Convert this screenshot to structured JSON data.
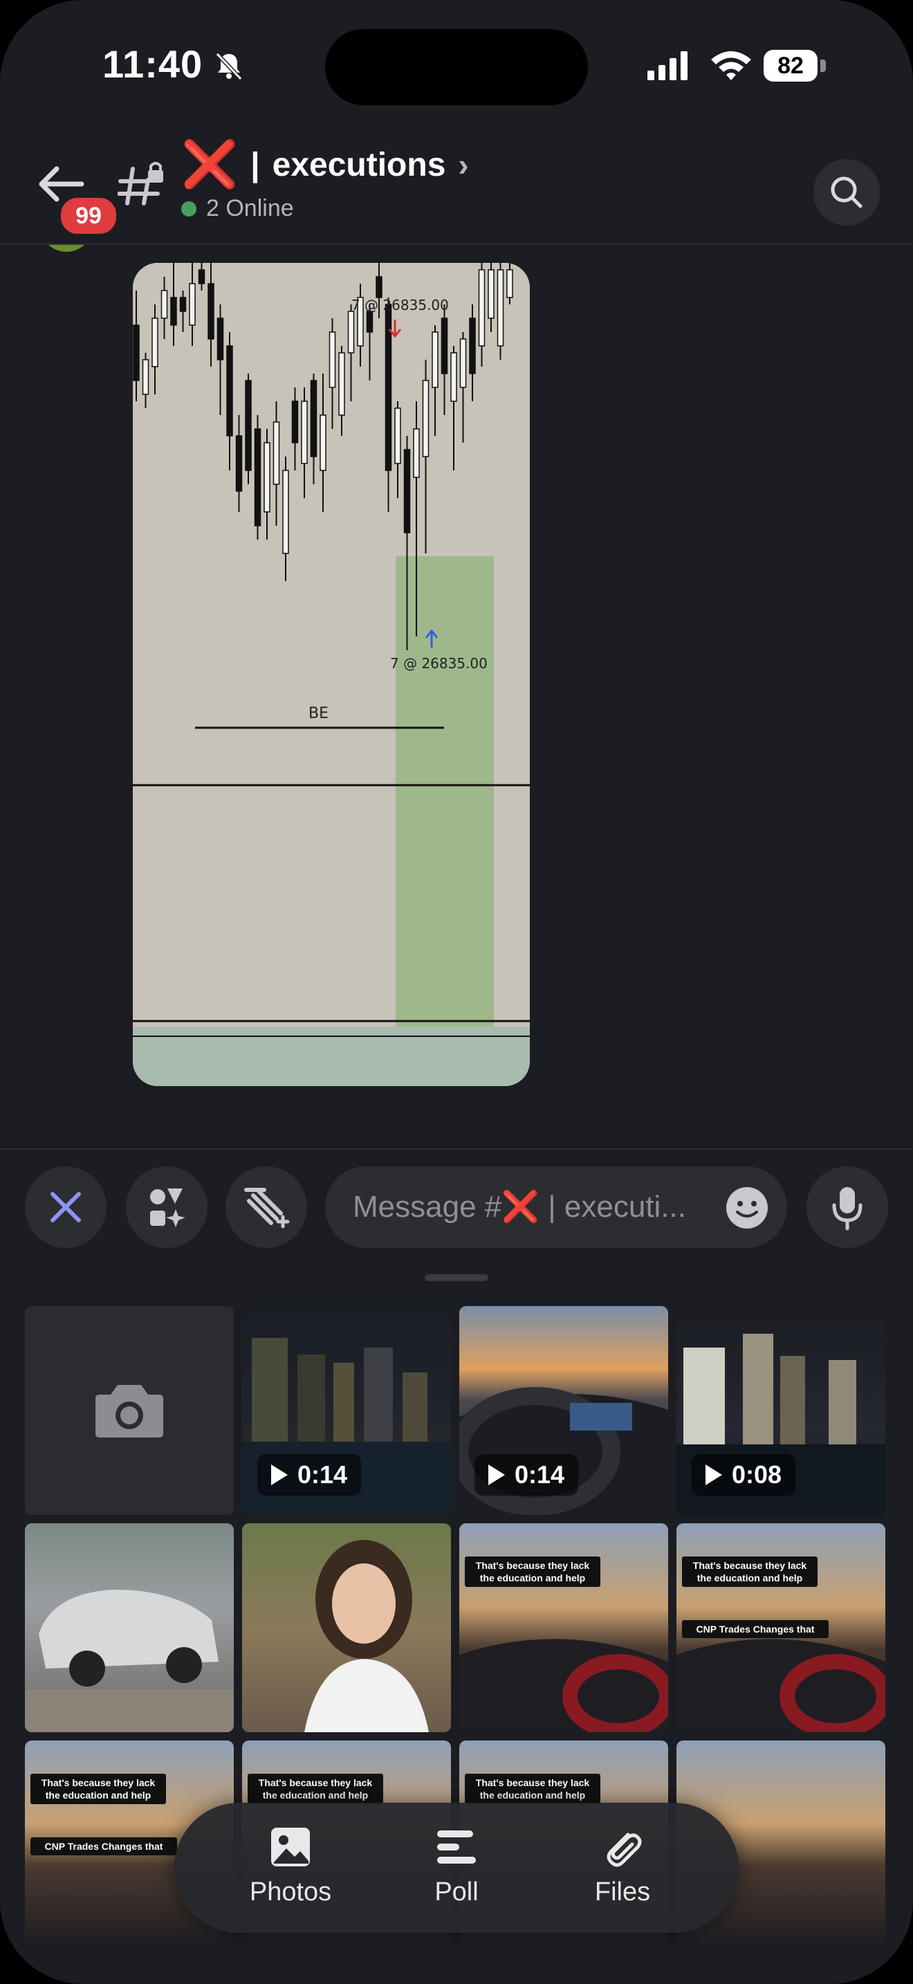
{
  "status_bar": {
    "time": "11:40",
    "battery": "82"
  },
  "header": {
    "unread_badge": "99",
    "channel_emoji": "❌",
    "channel_separator": "|",
    "channel_name": "executions",
    "chevron": "›",
    "online_text": "2 Online",
    "online_color": "#43a25a",
    "icons": [
      "back-arrow-icon",
      "locked-channel-icon",
      "search-icon"
    ]
  },
  "message": {
    "chart_labels": {
      "sell_label": "7 @ 26835.00",
      "buy_label": "7 @ 26835.00",
      "be_label": "BE"
    }
  },
  "composer": {
    "placeholder_prefix": "Message #",
    "placeholder_emoji": "❌",
    "placeholder_suffix": " | executi...",
    "icons": [
      "close-icon",
      "apps-icon",
      "gift-sparkle-icon",
      "emoji-icon",
      "microphone-icon"
    ],
    "accent": "#8e93f5"
  },
  "gallery": {
    "videos": [
      {
        "duration": "0:14"
      },
      {
        "duration": "0:14"
      },
      {
        "duration": "0:08"
      }
    ],
    "captions": {
      "education": "That's because they lack the education and help",
      "cnp": "CNP Trades Changes that"
    }
  },
  "attach_menu": {
    "photos": "Photos",
    "poll": "Poll",
    "files": "Files"
  }
}
